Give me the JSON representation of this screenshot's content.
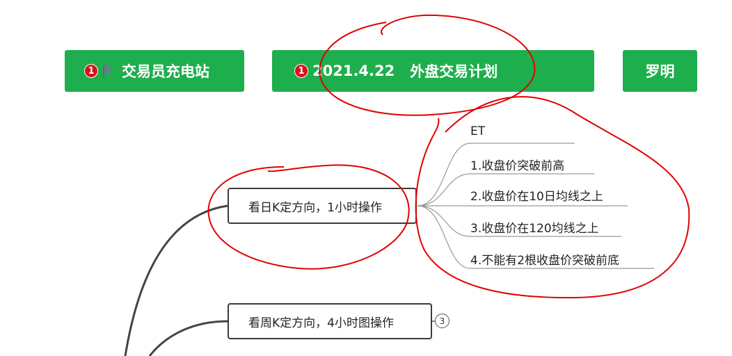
{
  "banners": [
    {
      "text": "交易员充电站",
      "badge": "1",
      "icon": "flag-icon"
    },
    {
      "date": "2021.4.22",
      "title": "外盘交易计划",
      "badge": "1"
    },
    {
      "text": "罗明"
    }
  ],
  "mindmap": {
    "branch1": {
      "label": "看日K定方向，1小时操作",
      "children": [
        "ET",
        "1.收盘价突破前高",
        "2.收盘价在10日均线之上",
        "3.收盘价在120均线之上",
        "4.不能有2根收盘价突破前底"
      ]
    },
    "branch2": {
      "label": "看周K定方向，4小时图操作",
      "collapsed_count": "3"
    }
  },
  "colors": {
    "banner_green": "#1fae4d",
    "badge_red": "#d8111a",
    "annotation_red": "#e00000",
    "node_border": "#3a3a3a"
  }
}
